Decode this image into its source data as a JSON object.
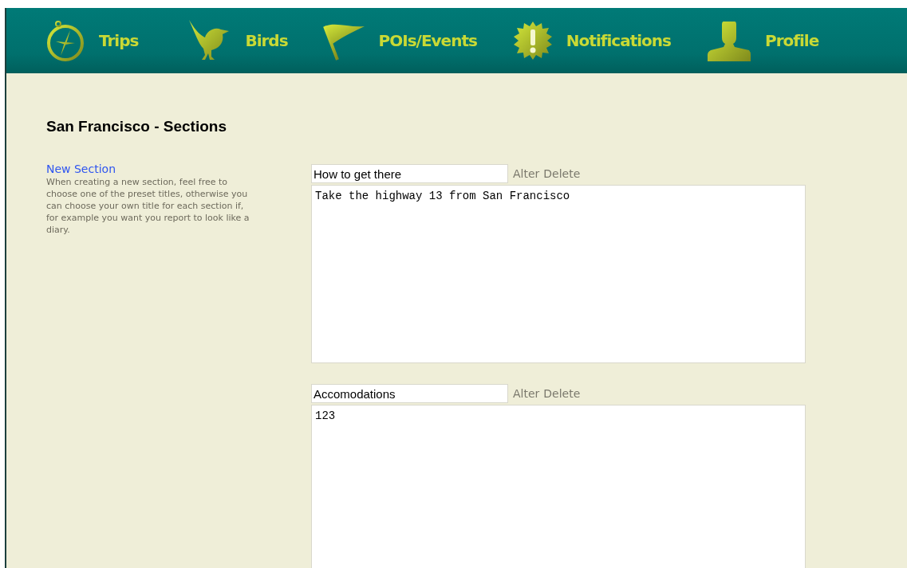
{
  "nav": [
    {
      "kind": "compass",
      "label": "Trips"
    },
    {
      "kind": "bird",
      "label": "Birds"
    },
    {
      "kind": "flag",
      "label": "POIs/Events"
    },
    {
      "kind": "alert",
      "label": "Notifications"
    },
    {
      "kind": "person",
      "label": "Profile"
    }
  ],
  "page_title": "San Francisco - Sections",
  "sidebar": {
    "link": "New Section",
    "help": "When creating a new section, feel free to choose one of the preset titles, otherwise you can choose your own title for each section if, for example you want you report to look like a diary."
  },
  "sections": [
    {
      "title": "How to get there",
      "actions": [
        "Alter",
        "Delete"
      ],
      "body": "Take the highway 13 from San Francisco"
    },
    {
      "title": "Accomodations",
      "actions": [
        "Alter",
        "Delete"
      ],
      "body": "123"
    }
  ]
}
